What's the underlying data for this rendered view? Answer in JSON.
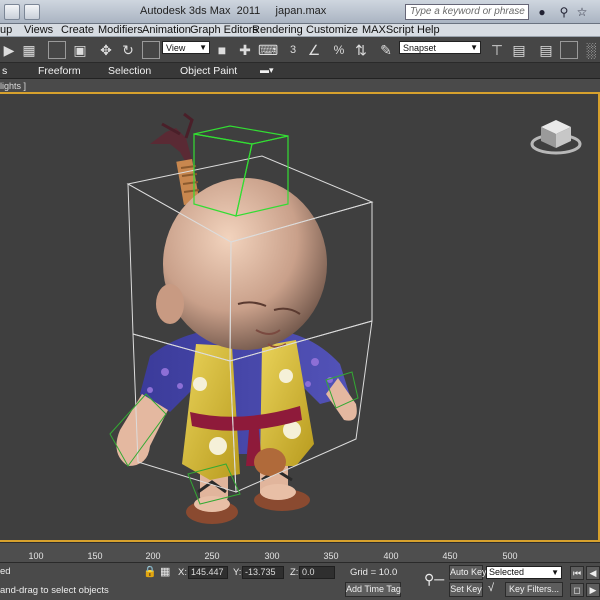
{
  "window": {
    "app_title": "Autodesk 3ds Max  2011",
    "file_name": "japan.max",
    "search_placeholder": "Type a keyword or phrase"
  },
  "menu": [
    {
      "id": "group",
      "label": "up"
    },
    {
      "id": "views",
      "label": "Views"
    },
    {
      "id": "create",
      "label": "Create"
    },
    {
      "id": "modifiers",
      "label": "Modifiers"
    },
    {
      "id": "animation",
      "label": "Animation"
    },
    {
      "id": "graph-editors",
      "label": "Graph Editors"
    },
    {
      "id": "rendering",
      "label": "Rendering"
    },
    {
      "id": "customize",
      "label": "Customize"
    },
    {
      "id": "maxscript",
      "label": "MAXScript"
    },
    {
      "id": "help",
      "label": "Help"
    }
  ],
  "toolbar": {
    "reference_coord": "View",
    "snap_number": "3",
    "named_selection": "Snapset"
  },
  "ribbon_tabs": [
    {
      "id": "graphite",
      "label": "s"
    },
    {
      "id": "freeform",
      "label": "Freeform"
    },
    {
      "id": "selection",
      "label": "Selection"
    },
    {
      "id": "object-paint",
      "label": "Object Paint"
    }
  ],
  "viewport": {
    "label": "lights ]"
  },
  "timeline": {
    "ticks": [
      "100",
      "150",
      "200",
      "250",
      "300",
      "350",
      "400",
      "450",
      "500"
    ]
  },
  "status": {
    "selection_state": "ed",
    "prompt": "and-drag to select objects",
    "x_label": "X:",
    "x_value": "145.447",
    "y_label": "Y:",
    "y_value": "-13.735",
    "z_label": "Z:",
    "z_value": "0.0",
    "grid": "Grid = 10.0",
    "add_time_tag": "Add Time Tag",
    "auto_key": "Auto Key",
    "set_key": "Set Key",
    "key_mode": "Selected",
    "key_filters": "Key Filters..."
  },
  "colors": {
    "viewport_border": "#d7a12d",
    "viewport_bg": "#3f3f3f",
    "selection_box": "#dcdcdc",
    "bone_box": "#33dd33"
  }
}
